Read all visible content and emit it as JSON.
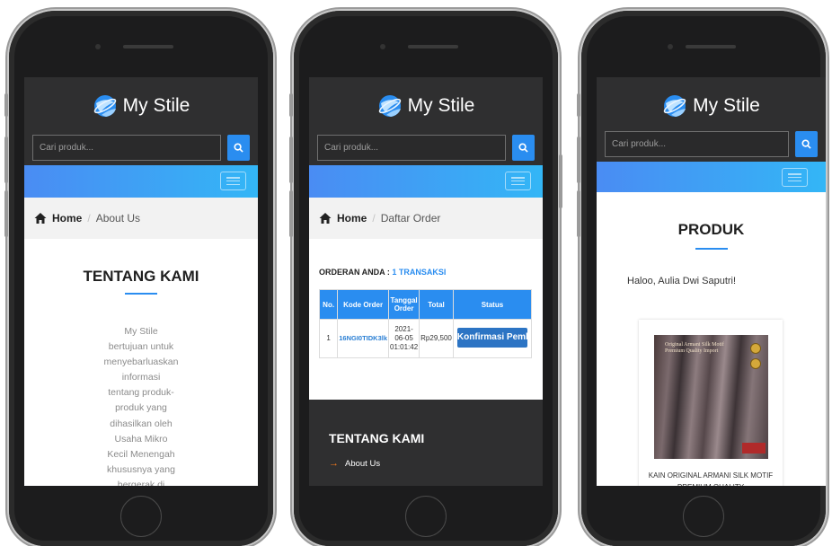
{
  "brand": "My Stile",
  "search_placeholder": "Cari produk...",
  "phones": [
    {
      "breadcrumb": {
        "home": "Home",
        "current": "About Us"
      },
      "heading": "TENTANG KAMI",
      "lines": [
        "My Stile",
        "bertujuan untuk",
        "menyebarluaskan",
        "informasi",
        "tentang produk-",
        "produk yang",
        "dihasilkan oleh",
        "Usaha Mikro",
        "Kecil Menengah",
        "khususnya yang",
        "bergerak di"
      ]
    },
    {
      "breadcrumb": {
        "home": "Home",
        "current": "Daftar Order"
      },
      "orders_label": "ORDERAN ANDA :",
      "orders_count": "1 TRANSAKSI",
      "columns": [
        "No.",
        "Kode Order",
        "Tanggal Order",
        "Total",
        "Status"
      ],
      "row": {
        "no": "1",
        "code": "16NGI0TIDK3lk",
        "date": [
          "2021-",
          "06-05",
          "01:01:42"
        ],
        "total": "Rp29,500",
        "status": "Konfirmasi Pembayaran"
      },
      "footer_title": "TENTANG KAMI",
      "footer_link": "About Us"
    },
    {
      "heading": "PRODUK",
      "greeting": "Haloo, Aulia Dwi Saputri!",
      "product_image_text": "Original Armani Silk Motif Premium Quality Import",
      "product_name": "KAIN ORIGINAL ARMANI SILK MOTIF PREMIUM QUALITY"
    }
  ],
  "colors": {
    "accent": "#2a8df0",
    "dark": "#2f2f30",
    "gradient_start": "#4a8cf3",
    "gradient_end": "#33b6f6",
    "footer_arrow": "#ff7d1a"
  },
  "icons": [
    "globe-logo-icon",
    "search-icon",
    "hamburger-icon",
    "home-icon",
    "arrow-right-icon"
  ]
}
